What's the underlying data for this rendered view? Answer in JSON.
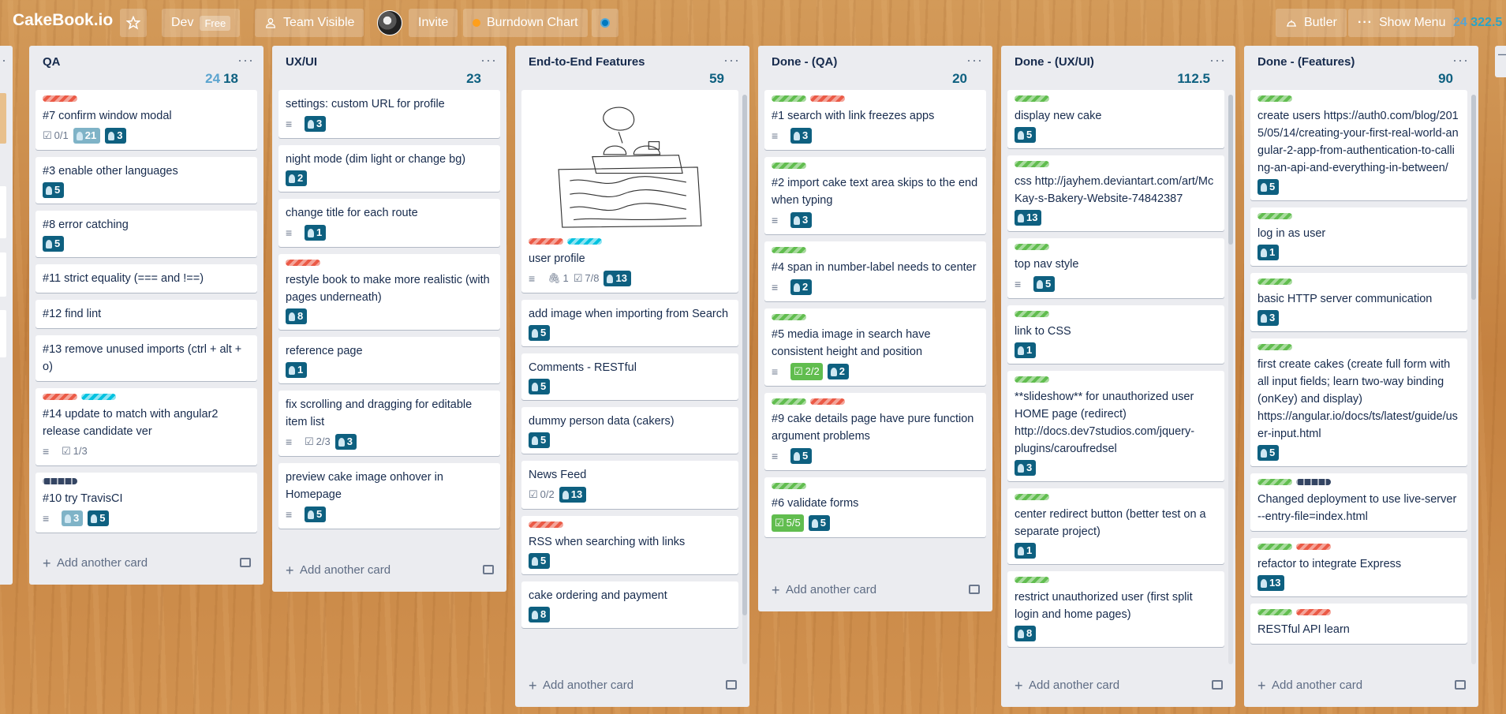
{
  "header": {
    "board_title": "CakeBook.io",
    "team_name": "Dev",
    "team_badge": "Free",
    "visibility": "Team Visible",
    "invite": "Invite",
    "burndown": "Burndown Chart",
    "butler": "Butler",
    "show_menu": "Show Menu",
    "points_a": "24",
    "points_b": "322.5"
  },
  "lists": [
    {
      "name": "QA",
      "points_dim": "24",
      "points": "18",
      "cards": [
        {
          "labels": [
            "red"
          ],
          "title": "#7 confirm window modal",
          "checklist": "0/1",
          "light_points": "21",
          "points": "3"
        },
        {
          "labels": [],
          "title": "#3 enable other languages",
          "points": "5"
        },
        {
          "labels": [],
          "title": "#8 error catching",
          "points": "5"
        },
        {
          "labels": [],
          "title": "#11 strict equality (=== and !==)"
        },
        {
          "labels": [],
          "title": "#12 find lint"
        },
        {
          "labels": [],
          "title": "#13 remove unused imports (ctrl + alt + o)"
        },
        {
          "labels": [
            "red",
            "sky"
          ],
          "title": "#14 update to match with angular2 release candidate ver",
          "desc": true,
          "checklist": "1/3"
        },
        {
          "labels": [
            "black"
          ],
          "title": "#10 try TravisCI",
          "desc": true,
          "light_points": "3",
          "points": "5"
        }
      ],
      "add": "Add another card"
    },
    {
      "name": "UX/UI",
      "points": "23",
      "cards": [
        {
          "labels": [],
          "title": "settings: custom URL for profile",
          "desc": true,
          "points": "3"
        },
        {
          "labels": [],
          "title": "night mode (dim light or change bg)",
          "points": "2"
        },
        {
          "labels": [],
          "title": "change title for each route",
          "desc": true,
          "points": "1"
        },
        {
          "labels": [
            "red"
          ],
          "title": "restyle book to make more realistic (with pages underneath)",
          "points": "8"
        },
        {
          "labels": [],
          "title": "reference page",
          "points": "1"
        },
        {
          "labels": [],
          "title": "fix scrolling and dragging for editable item list",
          "desc": true,
          "checklist": "2/3",
          "points": "3"
        },
        {
          "labels": [],
          "title": "preview cake image onhover in Homepage",
          "desc": true,
          "points": "5"
        }
      ],
      "add": "Add another card"
    },
    {
      "name": "End-to-End Features",
      "points": "59",
      "cards": [
        {
          "labels": [
            "red",
            "sky"
          ],
          "title": "user profile",
          "cover": true,
          "desc": true,
          "attachments": "1",
          "checklist": "7/8",
          "points": "13"
        },
        {
          "labels": [],
          "title": "add image when importing from Search",
          "points": "5"
        },
        {
          "labels": [],
          "title": "Comments - RESTful",
          "points": "5"
        },
        {
          "labels": [],
          "title": "dummy person data (cakers)",
          "points": "5"
        },
        {
          "labels": [],
          "title": "News Feed",
          "checklist": "0/2",
          "points": "13"
        },
        {
          "labels": [
            "red"
          ],
          "title": "RSS when searching with links",
          "points": "5"
        },
        {
          "labels": [],
          "title": "cake ordering and payment",
          "points": "8"
        }
      ],
      "add": "Add another card"
    },
    {
      "name": "Done - (QA)",
      "points": "20",
      "cards": [
        {
          "labels": [
            "green",
            "red"
          ],
          "title": "#1 search with link freezes apps",
          "desc": true,
          "points": "3"
        },
        {
          "labels": [
            "green"
          ],
          "title": "#2 import cake text area skips to the end when typing",
          "desc": true,
          "points": "3"
        },
        {
          "labels": [
            "green"
          ],
          "title": "#4 span in number-label needs to center",
          "desc": true,
          "points": "2"
        },
        {
          "labels": [
            "green"
          ],
          "title": "#5 media image in search have consistent height and position",
          "desc": true,
          "checklist_done": "2/2",
          "points": "2"
        },
        {
          "labels": [
            "green",
            "red"
          ],
          "title": "#9 cake details page have pure function argument problems",
          "desc": true,
          "points": "5"
        },
        {
          "labels": [
            "green"
          ],
          "title": "#6 validate forms",
          "checklist_done": "5/5",
          "points": "5"
        }
      ],
      "add": "Add another card"
    },
    {
      "name": "Done - (UX/UI)",
      "points": "112.5",
      "cards": [
        {
          "labels": [
            "green"
          ],
          "title": "display new cake",
          "points": "5"
        },
        {
          "labels": [
            "green"
          ],
          "title": "css http://jayhem.deviantart.com/art/McKay-s-Bakery-Website-74842387",
          "points": "13"
        },
        {
          "labels": [
            "green"
          ],
          "title": "top nav style",
          "desc": true,
          "points": "5"
        },
        {
          "labels": [
            "green"
          ],
          "title": "link to CSS",
          "points": "1"
        },
        {
          "labels": [
            "green"
          ],
          "title": "**slideshow** for unauthorized user HOME page (redirect) http://docs.dev7studios.com/jquery-plugins/caroufredsel",
          "points": "3"
        },
        {
          "labels": [
            "green"
          ],
          "title": "center redirect button (better test on a separate project)",
          "points": "1"
        },
        {
          "labels": [
            "green"
          ],
          "title": "restrict unauthorized user (first split login and home pages)",
          "points": "8"
        }
      ],
      "add": "Add another card"
    },
    {
      "name": "Done - (Features)",
      "points": "90",
      "cards": [
        {
          "labels": [
            "green"
          ],
          "title": "create users https://auth0.com/blog/2015/05/14/creating-your-first-real-world-angular-2-app-from-authentication-to-calling-an-api-and-everything-in-between/",
          "points": "5"
        },
        {
          "labels": [
            "green"
          ],
          "title": "log in as user",
          "points": "1"
        },
        {
          "labels": [
            "green"
          ],
          "title": "basic HTTP server communication",
          "points": "3"
        },
        {
          "labels": [
            "green"
          ],
          "title": "first create cakes (create full form with all input fields; learn two-way binding (onKey) and display) https://angular.io/docs/ts/latest/guide/user-input.html",
          "points": "5"
        },
        {
          "labels": [
            "green",
            "black"
          ],
          "title": "Changed deployment to use live-server --entry-file=index.html"
        },
        {
          "labels": [
            "green",
            "red"
          ],
          "title": "refactor to integrate Express",
          "points": "13"
        },
        {
          "labels": [
            "green",
            "red"
          ],
          "title": "RESTful API learn"
        }
      ],
      "add": "Add another card"
    }
  ]
}
